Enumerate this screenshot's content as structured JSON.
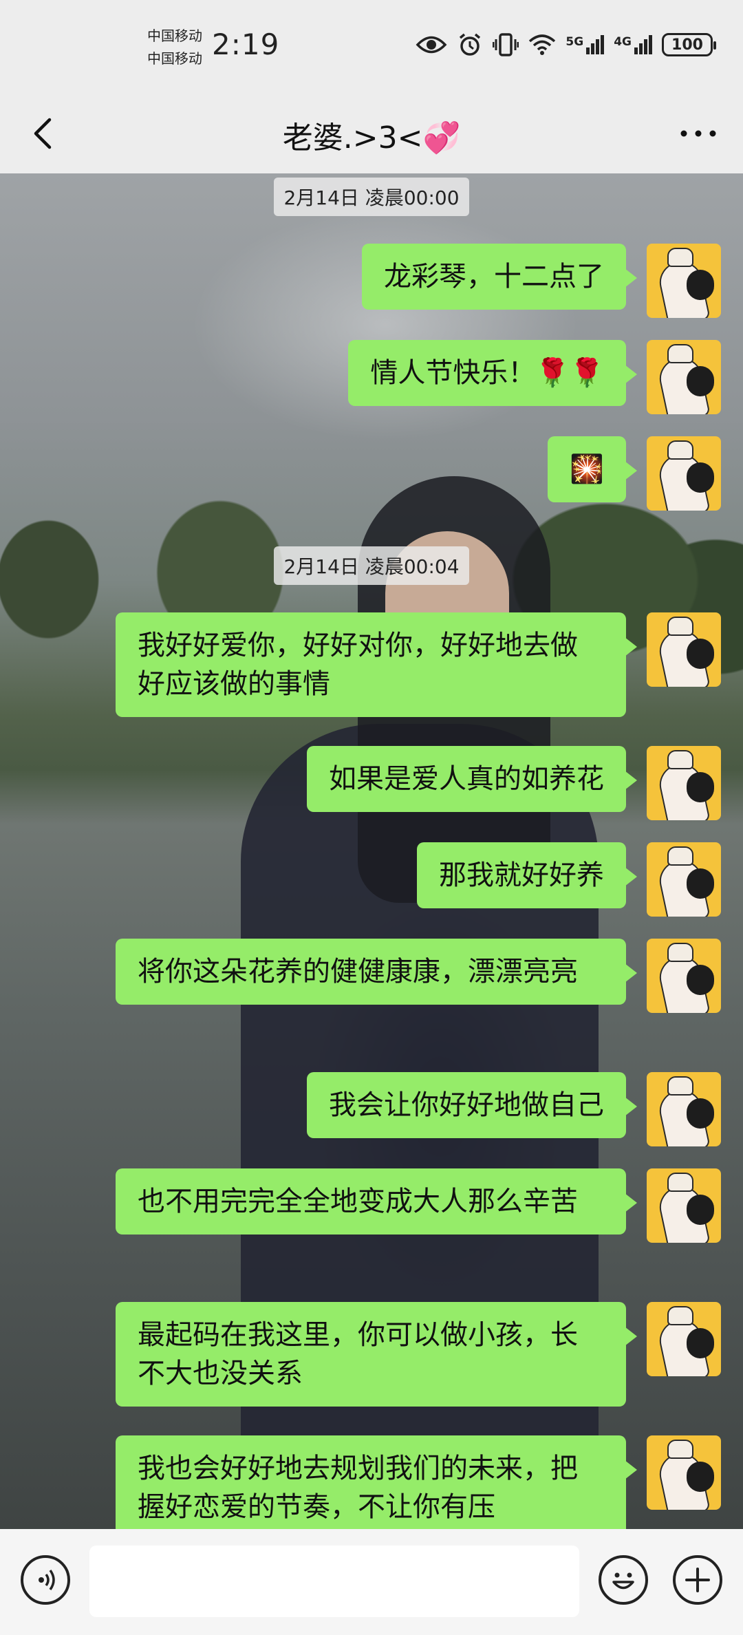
{
  "status_bar": {
    "carrier_1": "中国移动",
    "carrier_2": "中国移动",
    "time": "2:19",
    "network_1": "5G",
    "network_2": "4G",
    "battery": "100",
    "icons": [
      "eye-icon",
      "alarm-icon",
      "vibrate-icon",
      "wifi-icon",
      "signal-5g-icon",
      "signal-4g-icon",
      "battery-icon"
    ]
  },
  "header": {
    "title": "老婆.>3<💞",
    "back_icon": "chevron-left-icon",
    "more_icon": "more-dots-icon"
  },
  "chat": {
    "timestamps": [
      "2月14日 凌晨00:00",
      "2月14日 凌晨00:04"
    ],
    "messages": [
      {
        "text": "龙彩琴，十二点了",
        "sender": "me"
      },
      {
        "text": "情人节快乐！🌹🌹",
        "sender": "me"
      },
      {
        "text": "🎇",
        "sender": "me"
      },
      {
        "text": "我好好爱你，好好对你，好好地去做好应该做的事情",
        "sender": "me"
      },
      {
        "text": "如果是爱人真的如养花",
        "sender": "me"
      },
      {
        "text": "那我就好好养",
        "sender": "me"
      },
      {
        "text": "将你这朵花养的健健康康，漂漂亮亮",
        "sender": "me"
      },
      {
        "text": "我会让你好好地做自己",
        "sender": "me"
      },
      {
        "text": "也不用完完全全地变成大人那么辛苦",
        "sender": "me"
      },
      {
        "text": "最起码在我这里，你可以做小孩，长不大也没关系",
        "sender": "me"
      },
      {
        "text": "我也会好好地去规划我们的未来，把握好恋爱的节奏，不让你有压",
        "sender": "me"
      }
    ],
    "bubble_color": "#95EC69"
  },
  "input_bar": {
    "voice_icon": "voice-icon",
    "input_value": "",
    "emoji_icon": "emoji-icon",
    "plus_icon": "plus-icon"
  }
}
